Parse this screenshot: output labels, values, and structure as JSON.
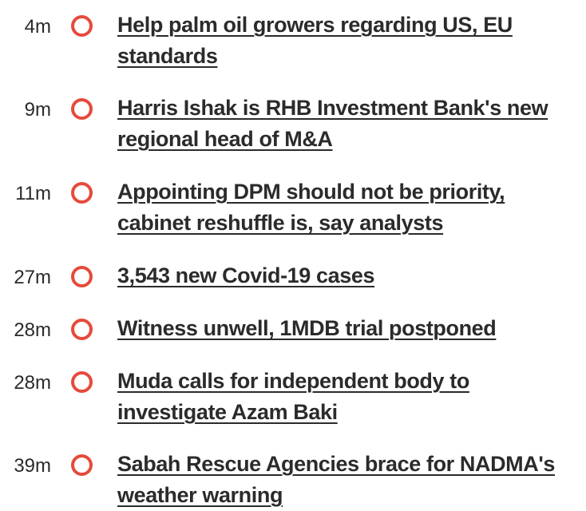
{
  "news": {
    "items": [
      {
        "time": "4m",
        "headline": "Help palm oil growers regarding US, EU standards"
      },
      {
        "time": "9m",
        "headline": "Harris Ishak is RHB Investment Bank's new regional head of M&A"
      },
      {
        "time": "11m",
        "headline": "Appointing DPM should not be priority, cabinet reshuffle is, say analysts"
      },
      {
        "time": "27m",
        "headline": "3,543 new Covid-19 cases"
      },
      {
        "time": "28m",
        "headline": "Witness unwell, 1MDB trial postponed"
      },
      {
        "time": "28m",
        "headline": "Muda calls for independent body to investigate Azam Baki"
      },
      {
        "time": "39m",
        "headline": "Sabah Rescue Agencies brace for NADMA's weather warning"
      }
    ]
  },
  "colors": {
    "bullet_ring": "#e64a3b",
    "headline_text": "#2b2b2b",
    "time_text": "#2a2a2a"
  },
  "icons": {
    "bullet": "circle-outline-icon"
  }
}
